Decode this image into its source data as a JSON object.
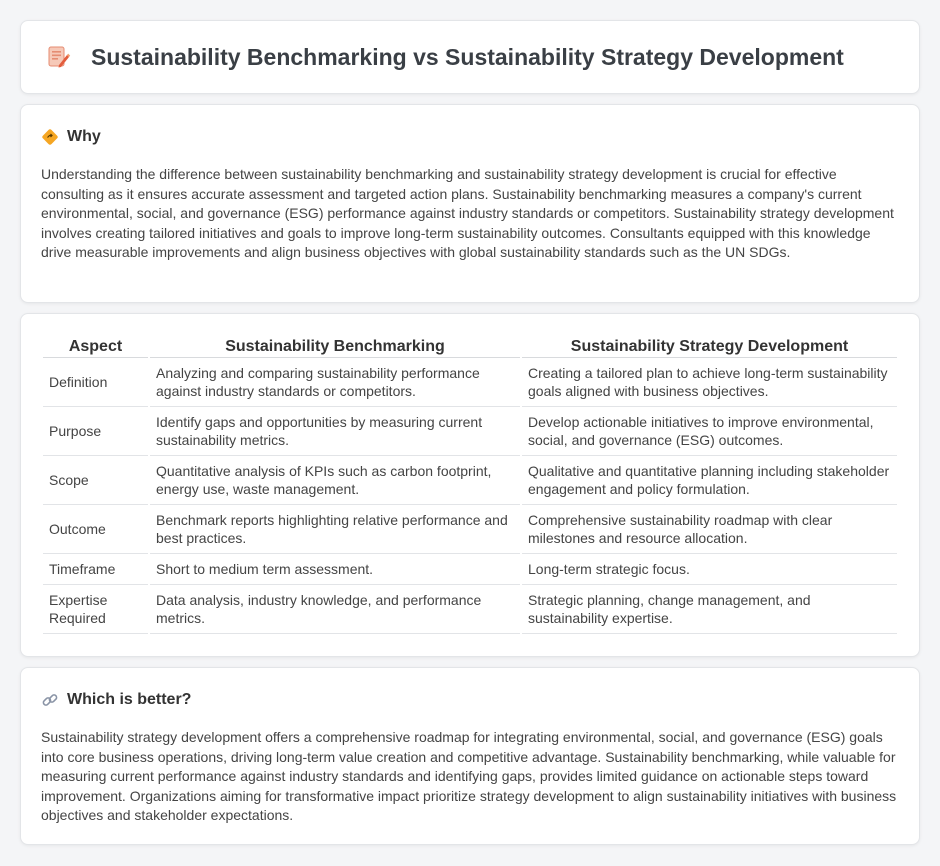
{
  "header": {
    "title": "Sustainability Benchmarking vs Sustainability Strategy Development",
    "icon": "document-edit-icon"
  },
  "why": {
    "title": "Why",
    "icon": "diamond-sign-icon",
    "text": "Understanding the difference between sustainability benchmarking and sustainability strategy development is crucial for effective consulting as it ensures accurate assessment and targeted action plans. Sustainability benchmarking measures a company's current environmental, social, and governance (ESG) performance against industry standards or competitors. Sustainability strategy development involves creating tailored initiatives and goals to improve long-term sustainability outcomes. Consultants equipped with this knowledge drive measurable improvements and align business objectives with global sustainability standards such as the UN SDGs."
  },
  "table": {
    "headers": [
      "Aspect",
      "Sustainability Benchmarking",
      "Sustainability Strategy Development"
    ],
    "rows": [
      [
        "Definition",
        "Analyzing and comparing sustainability performance against industry standards or competitors.",
        "Creating a tailored plan to achieve long-term sustainability goals aligned with business objectives."
      ],
      [
        "Purpose",
        "Identify gaps and opportunities by measuring current sustainability metrics.",
        "Develop actionable initiatives to improve environmental, social, and governance (ESG) outcomes."
      ],
      [
        "Scope",
        "Quantitative analysis of KPIs such as carbon footprint, energy use, waste management.",
        "Qualitative and quantitative planning including stakeholder engagement and policy formulation."
      ],
      [
        "Outcome",
        "Benchmark reports highlighting relative performance and best practices.",
        "Comprehensive sustainability roadmap with clear milestones and resource allocation."
      ],
      [
        "Timeframe",
        "Short to medium term assessment.",
        "Long-term strategic focus."
      ],
      [
        "Expertise Required",
        "Data analysis, industry knowledge, and performance metrics.",
        "Strategic planning, change management, and sustainability expertise."
      ]
    ]
  },
  "better": {
    "title": "Which is better?",
    "icon": "link-icon",
    "text": "Sustainability strategy development offers a comprehensive roadmap for integrating environmental, social, and governance (ESG) goals into core business operations, driving long-term value creation and competitive advantage. Sustainability benchmarking, while valuable for measuring current performance against industry standards and identifying gaps, provides limited guidance on actionable steps toward improvement. Organizations aiming for transformative impact prioritize strategy development to align sustainability initiatives with business objectives and stakeholder expectations."
  }
}
